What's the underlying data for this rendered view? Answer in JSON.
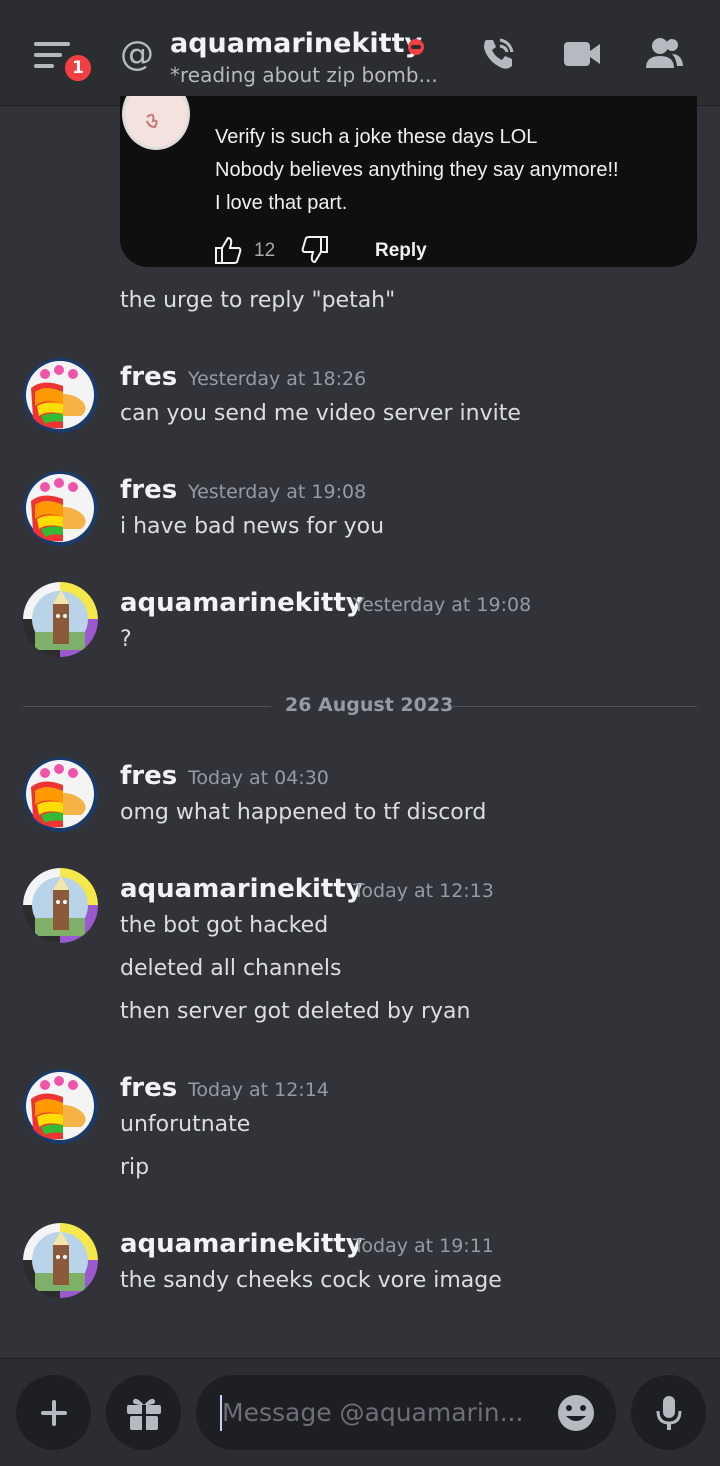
{
  "header": {
    "badge_count": "1",
    "title": "aquamarinekitty",
    "status_text": "*reading about zip bomb...",
    "status_color": "#f23f43"
  },
  "quote_card": {
    "lines": [
      "Verify is such a joke these days LOL",
      "Nobody believes anything they say anymore!!",
      "I love that part."
    ],
    "like_count": "12",
    "reply_label": "Reply"
  },
  "messages": [
    {
      "text": "the urge to reply \"petah\""
    },
    {
      "author": "fres",
      "time": "Yesterday at 18:26",
      "lines": [
        "can you send me video server invite"
      ]
    },
    {
      "author": "fres",
      "time": "Yesterday at 19:08",
      "lines": [
        "i have bad news for you"
      ]
    },
    {
      "author": "aquamarinekitty",
      "time": "Yesterday at 19:08",
      "lines": [
        "?"
      ]
    },
    {
      "author": "fres",
      "time": "Today at 04:30",
      "lines": [
        "omg what happened to tf discord"
      ]
    },
    {
      "author": "aquamarinekitty",
      "time": "Today at 12:13",
      "lines": [
        "the bot got hacked",
        "deleted all channels",
        "then server got deleted by ryan"
      ]
    },
    {
      "author": "fres",
      "time": "Today at 12:14",
      "lines": [
        "unforutnate",
        "rip"
      ]
    },
    {
      "author": "aquamarinekitty",
      "time": "Today at 19:11",
      "lines": [
        "the sandy cheeks cock vore image"
      ]
    }
  ],
  "date_divider": "26 August 2023",
  "composer": {
    "placeholder": "Message @aquamarin..."
  },
  "icons": {
    "menu": "hamburger-menu-icon",
    "at": "at-sign-icon",
    "call": "phone-call-icon",
    "video": "video-camera-icon",
    "members": "members-icon",
    "add": "plus-icon",
    "gift": "gift-icon",
    "emoji": "emoji-icon",
    "mic": "microphone-icon"
  }
}
